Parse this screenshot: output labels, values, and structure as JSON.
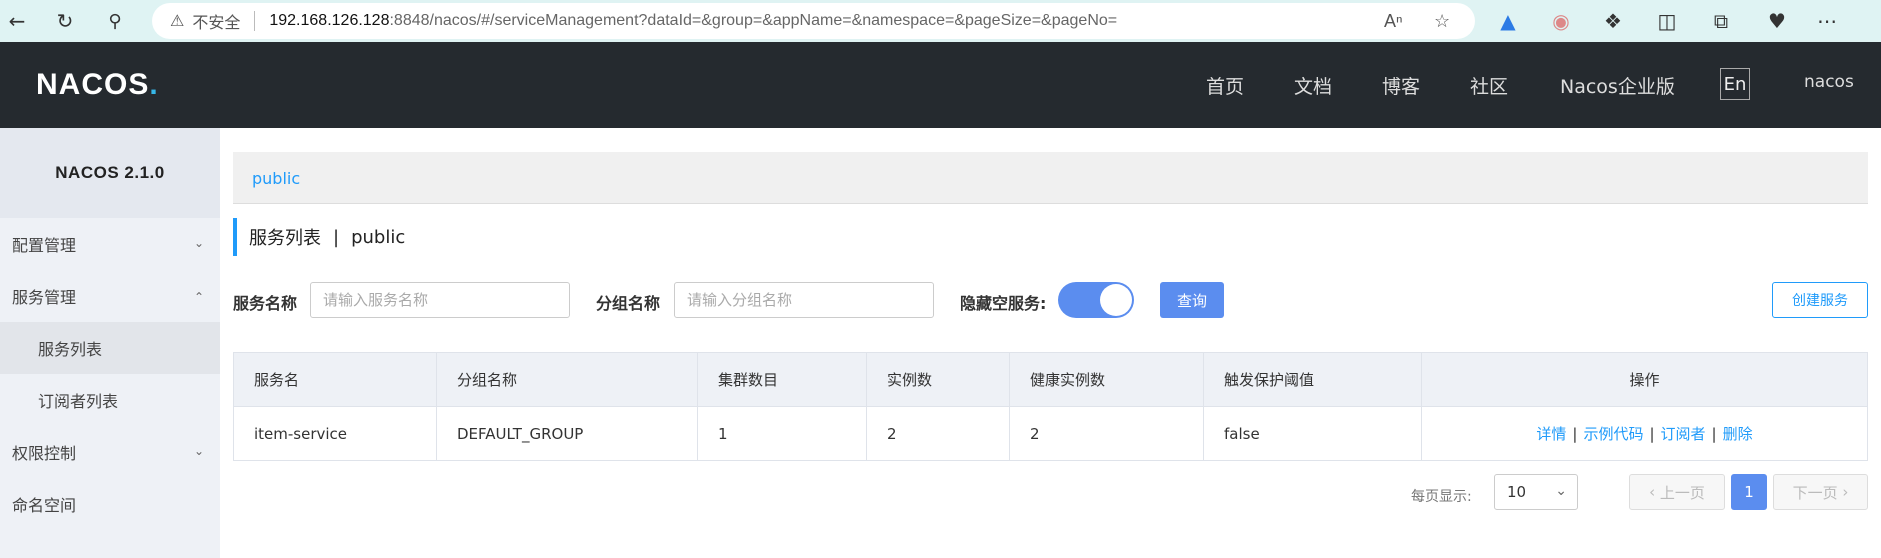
{
  "browser": {
    "back_icon": "arrow-left-icon",
    "refresh_icon": "refresh-icon",
    "search_icon": "search-icon",
    "insecure_label": "不安全",
    "url_host": "192.168.126.128",
    "url_rest": ":8848/nacos/#/serviceManagement?dataId=&group=&appName=&namespace=&pageSize=&pageNo="
  },
  "header": {
    "logo": "NACOS",
    "logo_dot": ".",
    "nav": [
      "首页",
      "文档",
      "博客",
      "社区",
      "Nacos企业版"
    ],
    "lang": "En",
    "user": "nacos"
  },
  "sidebar": {
    "version": "NACOS 2.1.0",
    "items": [
      {
        "label": "配置管理"
      },
      {
        "label": "服务管理"
      },
      {
        "label": "服务列表"
      },
      {
        "label": "订阅者列表"
      },
      {
        "label": "权限控制"
      },
      {
        "label": "命名空间"
      }
    ]
  },
  "main": {
    "namespace": "public",
    "title": "服务列表",
    "title_sep": "|",
    "title_ns": "public",
    "filters": {
      "service_label": "服务名称",
      "service_placeholder": "请输入服务名称",
      "group_label": "分组名称",
      "group_placeholder": "请输入分组名称",
      "hide_empty_label": "隐藏空服务:",
      "hide_empty_on": true,
      "query_button": "查询",
      "create_button": "创建服务"
    },
    "table": {
      "headers": [
        "服务名",
        "分组名称",
        "集群数目",
        "实例数",
        "健康实例数",
        "触发保护阈值",
        "操作"
      ],
      "rows": [
        {
          "name": "item-service",
          "group": "DEFAULT_GROUP",
          "clusters": "1",
          "instances": "2",
          "healthy": "2",
          "protect": "false"
        }
      ],
      "ops": [
        "详情",
        "示例代码",
        "订阅者",
        "删除"
      ]
    },
    "pager": {
      "page_size_label": "每页显示:",
      "page_size": "10",
      "prev": "上一页",
      "current": "1",
      "next": "下一页"
    }
  },
  "colors": {
    "accent": "#209bfa",
    "primary_button": "#5b8def",
    "topnav": "#252a2f"
  }
}
